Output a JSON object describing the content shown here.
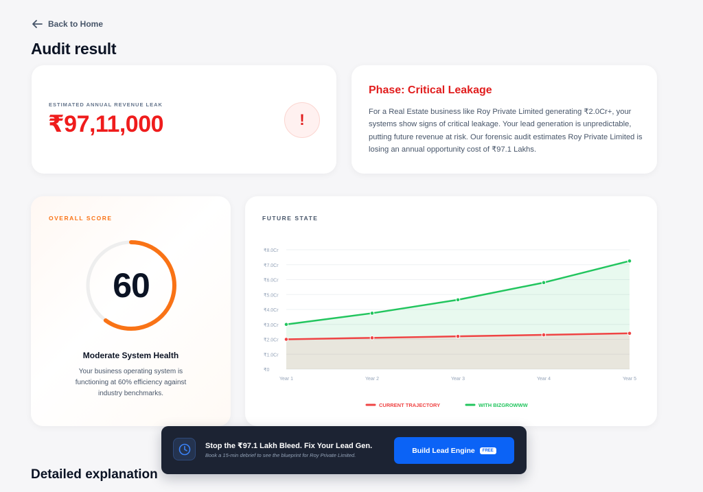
{
  "nav": {
    "back_label": "Back to Home"
  },
  "page": {
    "title": "Audit result",
    "section_heading": "Detailed explanation"
  },
  "leak": {
    "label": "ESTIMATED ANNUAL REVENUE LEAK",
    "value": "₹97,11,000",
    "alert_symbol": "!"
  },
  "phase": {
    "title": "Phase: Critical Leakage",
    "description": "For a Real Estate business like Roy Private Limited generating ₹2.0Cr+, your systems show signs of critical leakage. Your lead generation is unpredictable, putting future revenue at risk. Our forensic audit estimates Roy Private Limited is losing an annual opportunity cost of ₹97.1 Lakhs."
  },
  "score": {
    "label": "OVERALL SCORE",
    "value": "60",
    "percent": 60,
    "health_title": "Moderate System Health",
    "health_text": "Your business operating system is functioning at 60% efficiency against industry benchmarks."
  },
  "future": {
    "label": "FUTURE STATE"
  },
  "chart_data": {
    "type": "line",
    "title": "",
    "categories": [
      "Year 1",
      "Year 2",
      "Year 3",
      "Year 4",
      "Year 5"
    ],
    "y_ticks": [
      "₹0",
      "₹1.0Cr",
      "₹2.0Cr",
      "₹3.0Cr",
      "₹4.0Cr",
      "₹5.0Cr",
      "₹6.0Cr",
      "₹7.0Cr",
      "₹8.0Cr"
    ],
    "ylim": [
      0,
      8
    ],
    "y_unit": "Cr",
    "grid": true,
    "legend_placement": "bottom",
    "series": [
      {
        "name": "CURRENT TRAJECTORY",
        "color": "#ef4444",
        "values": [
          2.0,
          2.1,
          2.2,
          2.3,
          2.4
        ]
      },
      {
        "name": "WITH BIZGROWWW",
        "color": "#22c55e",
        "values": [
          3.0,
          3.75,
          4.65,
          5.8,
          7.25
        ]
      }
    ]
  },
  "cta": {
    "title": "Stop the ₹97.1 Lakh Bleed. Fix Your Lead Gen.",
    "subtitle": "Book a 15-min debrief to see the blueprint for Roy Private Limited.",
    "button_label": "Build Lead Engine",
    "badge": "FREE"
  },
  "colors": {
    "accent_red": "#ef1c1c",
    "accent_orange": "#f97316",
    "accent_green": "#22c55e",
    "accent_blue": "#0b63f6",
    "cta_background": "#1c2333"
  },
  "icons": {
    "back": "arrow-left-icon",
    "alert": "exclamation-icon",
    "cta": "clock-icon"
  }
}
